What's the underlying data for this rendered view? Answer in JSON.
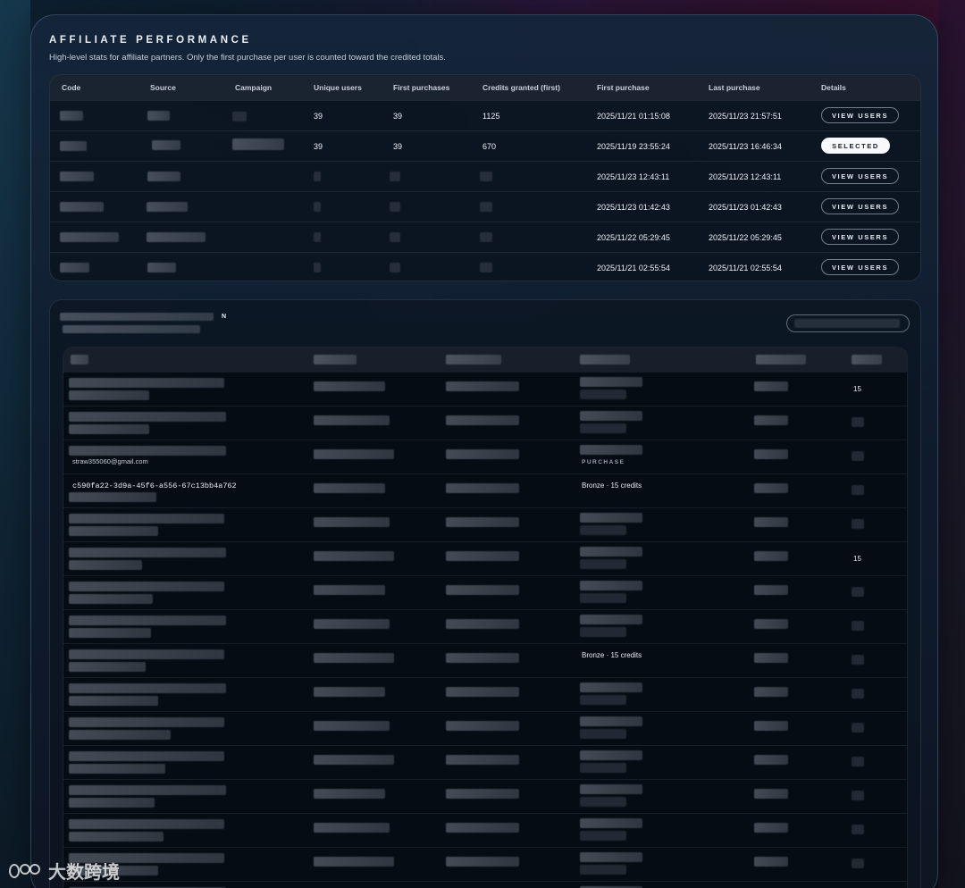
{
  "header": {
    "title": "AFFILIATE PERFORMANCE",
    "subtitle": "High-level stats for affiliate partners. Only the first purchase per user is counted toward the credited totals."
  },
  "summary_table": {
    "columns": [
      "Code",
      "Source",
      "Campaign",
      "Unique users",
      "First purchases",
      "Credits granted (first)",
      "First purchase",
      "Last purchase",
      "Details"
    ],
    "rows": [
      {
        "unique_users": "39",
        "first_purchases": "39",
        "credits": "1125",
        "first_purchase": "2025/11/21 01:15:08",
        "last_purchase": "2025/11/23 21:57:51",
        "action": "VIEW USERS",
        "selected": false
      },
      {
        "unique_users": "39",
        "first_purchases": "39",
        "credits": "670",
        "first_purchase": "2025/11/19 23:55:24",
        "last_purchase": "2025/11/23 16:46:34",
        "action": "SELECTED",
        "selected": true
      },
      {
        "unique_users": "",
        "first_purchases": "",
        "credits": "",
        "first_purchase": "2025/11/23 12:43:11",
        "last_purchase": "2025/11/23 12:43:11",
        "action": "VIEW USERS",
        "selected": false
      },
      {
        "unique_users": "",
        "first_purchases": "",
        "credits": "",
        "first_purchase": "2025/11/23 01:42:43",
        "last_purchase": "2025/11/23 01:42:43",
        "action": "VIEW USERS",
        "selected": false
      },
      {
        "unique_users": "",
        "first_purchases": "",
        "credits": "",
        "first_purchase": "2025/11/22 05:29:45",
        "last_purchase": "2025/11/22 05:29:45",
        "action": "VIEW USERS",
        "selected": false
      },
      {
        "unique_users": "",
        "first_purchases": "",
        "credits": "",
        "first_purchase": "2025/11/21 02:55:54",
        "last_purchase": "2025/11/21 02:55:54",
        "action": "VIEW USERS",
        "selected": false
      }
    ]
  },
  "users_table": {
    "heading_suffix": "N",
    "visible_texts": {
      "row1_last": "15",
      "row3_email": "straw355060@gmail.com",
      "row3_tag": "PURCHASE",
      "row4_id": "c590fa22-3d9a-45f6-a556-67c13bb4a762",
      "row4_plan": "Bronze · 15 credits",
      "row6_last": "15",
      "row9_plan": "Bronze · 15 credits"
    }
  },
  "watermark": {
    "text": "大数跨境"
  }
}
